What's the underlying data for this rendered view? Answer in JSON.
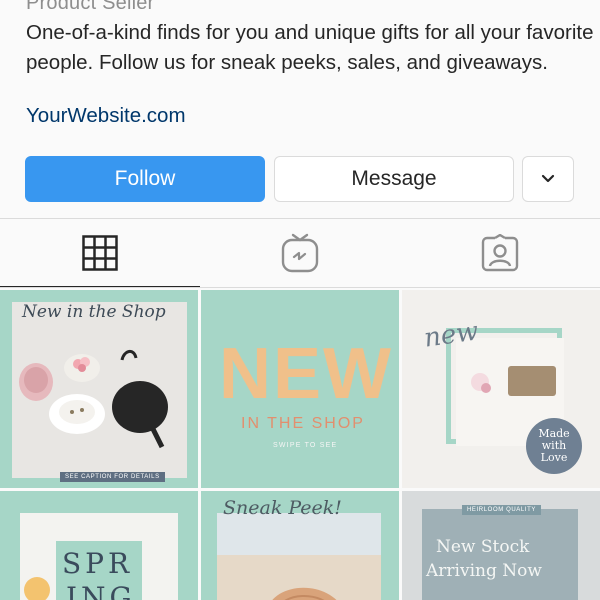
{
  "profile": {
    "category": "Product Seller",
    "bio": "One-of-a-kind finds for you and unique gifts for all your favorite people. Follow us for sneak peeks, sales, and giveaways.",
    "website": "YourWebsite.com"
  },
  "actions": {
    "follow_label": "Follow",
    "message_label": "Message",
    "more_icon": "chevron-down-icon"
  },
  "tabs": [
    {
      "icon": "grid-icon",
      "active": true
    },
    {
      "icon": "igtv-icon",
      "active": false
    },
    {
      "icon": "tagged-icon",
      "active": false
    }
  ],
  "posts": [
    {
      "title": "New in the Shop",
      "tag": "SEE CAPTION FOR DETAILS"
    },
    {
      "big": "NEW",
      "subtitle": "IN THE SHOP",
      "note": "SWIPE TO SEE"
    },
    {
      "title": "new",
      "badge": [
        "Made",
        "with",
        "Love"
      ]
    },
    {
      "title": "SPR",
      "title2": "ING"
    },
    {
      "title": "Sneak Peek!"
    },
    {
      "tag": "HEIRLOOM QUALITY",
      "title": "New Stock",
      "title2": "Arriving Now"
    }
  ],
  "colors": {
    "accent": "#3897f0",
    "mint": "#a6d6c7",
    "text": "#262626",
    "link": "#00376b",
    "muted": "#8e8e8e",
    "border": "#dbdbdb"
  }
}
